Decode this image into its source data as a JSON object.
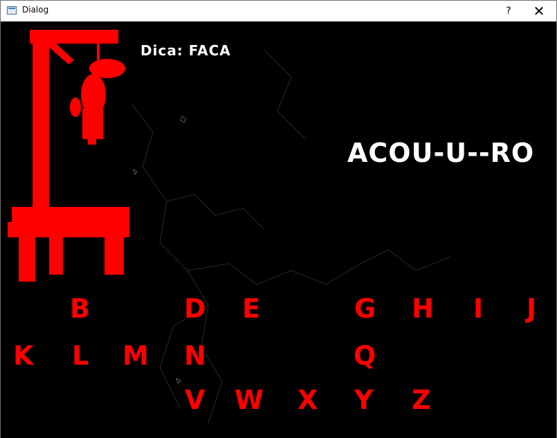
{
  "window": {
    "title": "Dialog",
    "help_label": "?",
    "close_label": "✕"
  },
  "game": {
    "hint": "Dica: FACA",
    "word_display": "ACOU-U--RO"
  },
  "letters": {
    "row1": {
      "b": "B",
      "d": "D",
      "e": "E",
      "g": "G",
      "h": "H",
      "i": "I",
      "j": "J"
    },
    "row2": {
      "k": "K",
      "l": "L",
      "m": "M",
      "n": "N",
      "q": "Q"
    },
    "row3": {
      "v": "V",
      "w": "W",
      "x": "X",
      "y": "Y",
      "z": "Z"
    }
  },
  "colors": {
    "accent": "#ff0000",
    "background": "#000000",
    "text": "#ffffff"
  }
}
